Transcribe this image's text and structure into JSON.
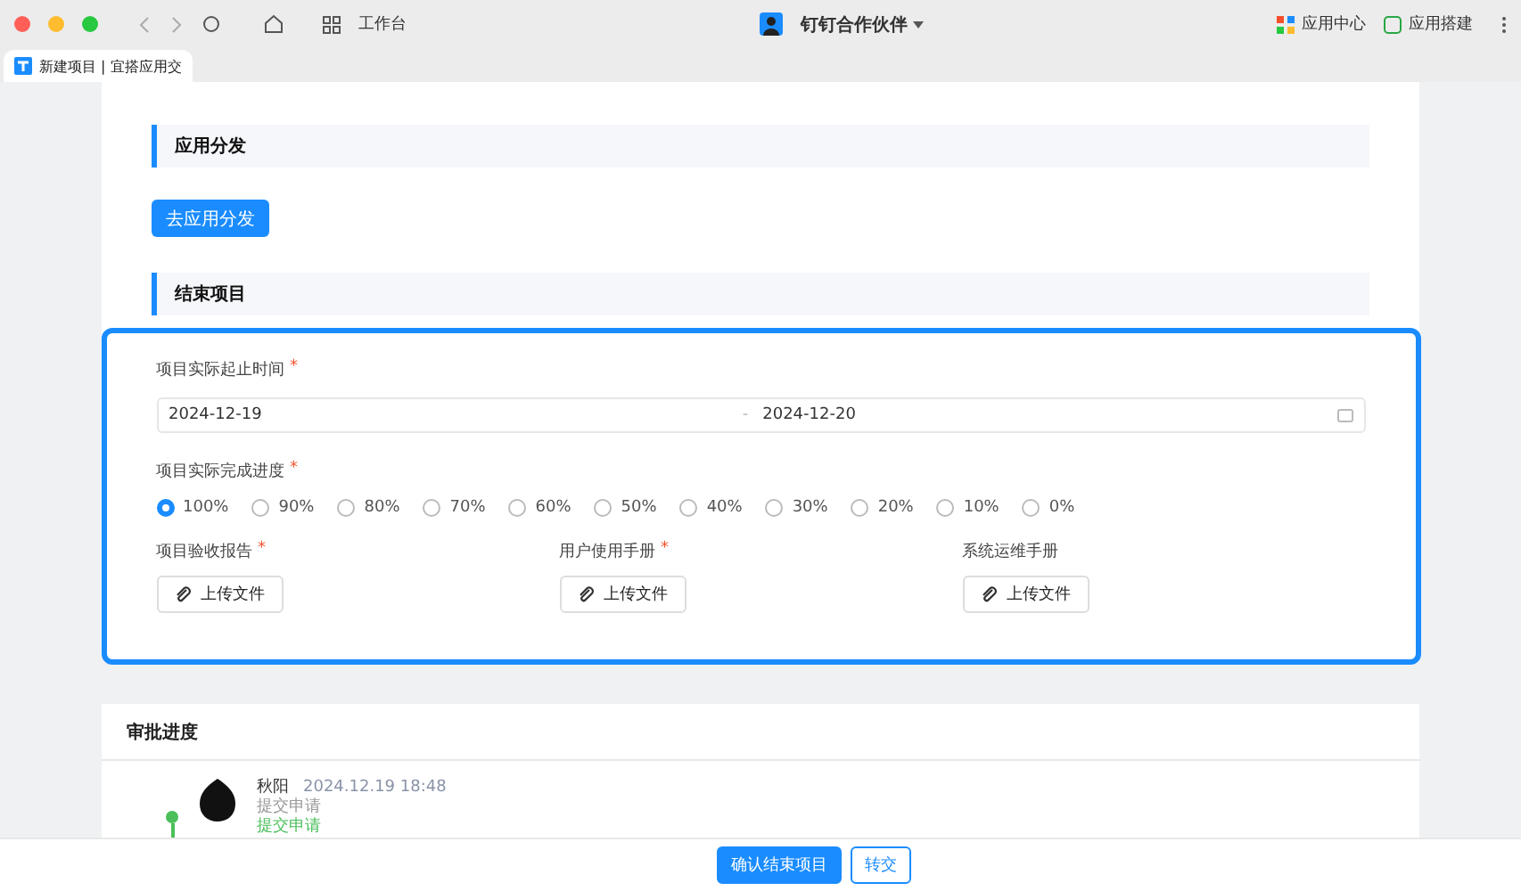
{
  "toolbar": {
    "workspace": "工作台",
    "title": "钉钉合作伙伴",
    "apps": [
      "应用中心",
      "应用搭建"
    ]
  },
  "tab": {
    "label": "新建项目 | 宜搭应用交"
  },
  "distribution": {
    "title": "应用分发",
    "button": "去应用分发"
  },
  "finish": {
    "title": "结束项目",
    "date_label": "项目实际起止时间",
    "date_mark": "*",
    "start": "2024-12-19",
    "separator": "-",
    "end": "2024-12-20",
    "progress_label": "项目实际完成进度",
    "progress_mark": "*",
    "progress_options": [
      {
        "label": "100%",
        "selected": true
      },
      {
        "label": "90%",
        "selected": false
      },
      {
        "label": "80%",
        "selected": false
      },
      {
        "label": "70%",
        "selected": false
      },
      {
        "label": "60%",
        "selected": false
      },
      {
        "label": "50%",
        "selected": false
      },
      {
        "label": "40%",
        "selected": false
      },
      {
        "label": "30%",
        "selected": false
      },
      {
        "label": "20%",
        "selected": false
      },
      {
        "label": "10%",
        "selected": false
      },
      {
        "label": "0%",
        "selected": false
      }
    ],
    "uploads": [
      {
        "label": "项目验收报告",
        "mark": "*",
        "button": "上传文件"
      },
      {
        "label": "用户使用手册",
        "mark": "*",
        "button": "上传文件"
      },
      {
        "label": "系统运维手册",
        "button": "上传文件"
      }
    ]
  },
  "approval": {
    "title": "审批进度",
    "entries": [
      {
        "name": "秋阳",
        "time": "2024.12.19 18:48",
        "action": "提交申请",
        "status": "提交申请"
      }
    ]
  },
  "footer": {
    "buttons": [
      "确认结束项目",
      "转交"
    ]
  }
}
